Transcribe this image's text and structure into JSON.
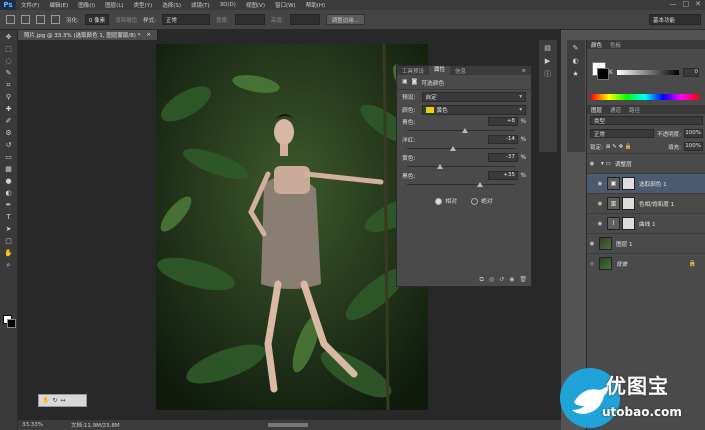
{
  "menubar": {
    "logo": "Ps",
    "items": [
      "文件(F)",
      "编辑(E)",
      "图像(I)",
      "图层(L)",
      "类型(Y)",
      "选择(S)",
      "滤镜(T)",
      "3D(D)",
      "视图(V)",
      "窗口(W)",
      "帮助(H)"
    ],
    "window_controls": [
      "—",
      "□",
      "✕"
    ]
  },
  "options": {
    "feather_label": "羽化:",
    "feather_value": "0 像素",
    "antialias_label": "消除锯齿",
    "style_label": "样式:",
    "style_value": "正常",
    "width_label": "宽度:",
    "height_label": "高度:",
    "refine_button": "调整边缘...",
    "workspace": "基本功能"
  },
  "document": {
    "tab_title": "照片.jpg @ 33.3% (选取颜色 1, 图层蒙版/8) *",
    "tab_close": "×",
    "zoom": "33.33%",
    "doc_info": "文档:11.9M/23.8M"
  },
  "properties": {
    "tabs": [
      "工具预设",
      "属性",
      "信息"
    ],
    "active_tab": 1,
    "title": "可选颜色",
    "preset_label": "预设:",
    "preset_value": "自定",
    "colors_label": "颜色:",
    "colors_value": "黄色",
    "sliders": [
      {
        "label": "青色:",
        "value": "+8",
        "pct": "%",
        "thumb": 0.54
      },
      {
        "label": "洋红:",
        "value": "-14",
        "pct": "%",
        "thumb": 0.43
      },
      {
        "label": "黄色:",
        "value": "-37",
        "pct": "%",
        "thumb": 0.31
      },
      {
        "label": "黑色:",
        "value": "+35",
        "pct": "%",
        "thumb": 0.68
      }
    ],
    "radio_relative": "相对",
    "radio_absolute": "绝对",
    "relative_selected": true
  },
  "color_panel": {
    "tabs": [
      "颜色",
      "色板"
    ],
    "k_label": "K",
    "k_value": "0"
  },
  "layers_panel": {
    "tabs": [
      "图层",
      "通道",
      "路径"
    ],
    "kind_value": "类型",
    "blend_value": "正常",
    "opacity_label": "不透明度:",
    "opacity_value": "100%",
    "lock_label": "锁定:",
    "fill_label": "填充:",
    "fill_value": "100%",
    "layers": [
      {
        "name": "调整层",
        "type": "group",
        "selected": false
      },
      {
        "name": "选取颜色 1",
        "type": "adjustment",
        "selected": true
      },
      {
        "name": "色相/饱和度 1",
        "type": "adjustment",
        "selected": false
      },
      {
        "name": "曲线 1",
        "type": "adjustment",
        "selected": false
      },
      {
        "name": "图层 1",
        "type": "image",
        "selected": false
      },
      {
        "name": "背景",
        "type": "image",
        "selected": false
      }
    ]
  },
  "watermark": {
    "title": "优图宝",
    "sub": "utobao.com"
  },
  "colors": {
    "accent": "#1fa3d9",
    "yellow_swatch": "#e8d20a",
    "selected_layer": "#4b5a6e"
  }
}
